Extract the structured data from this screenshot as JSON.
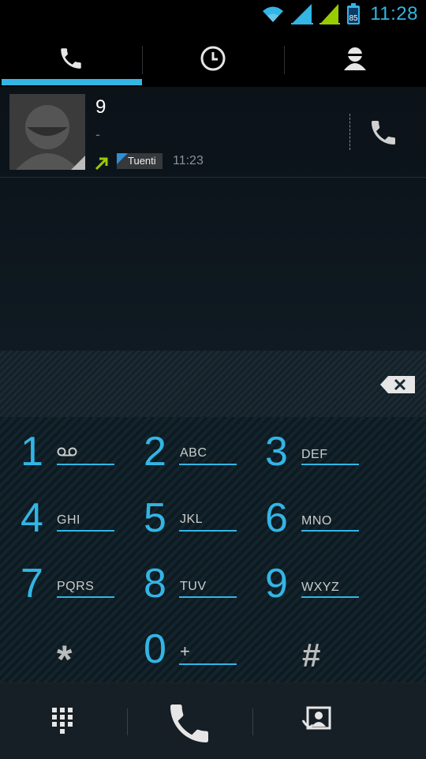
{
  "status_bar": {
    "time": "11:28",
    "battery_level": "85",
    "accent": "#33b5e5"
  },
  "tabs": [
    {
      "id": "phone",
      "icon": "phone-icon",
      "selected": true
    },
    {
      "id": "history",
      "icon": "clock-icon",
      "selected": false
    },
    {
      "id": "contacts",
      "icon": "person-icon",
      "selected": false
    }
  ],
  "call_log": {
    "entry": {
      "name": "9",
      "number_type": "-",
      "direction": "outgoing",
      "account": "Tuenti",
      "time": "11:23"
    }
  },
  "keypad": {
    "keys": [
      {
        "num": "1",
        "letters": ""
      },
      {
        "num": "2",
        "letters": "ABC"
      },
      {
        "num": "3",
        "letters": "DEF"
      },
      {
        "num": "4",
        "letters": "GHI"
      },
      {
        "num": "5",
        "letters": "JKL"
      },
      {
        "num": "6",
        "letters": "MNO"
      },
      {
        "num": "7",
        "letters": "PQRS"
      },
      {
        "num": "8",
        "letters": "TUV"
      },
      {
        "num": "9",
        "letters": "WXYZ"
      },
      {
        "num": "*",
        "letters": ""
      },
      {
        "num": "0",
        "letters": "+"
      },
      {
        "num": "#",
        "letters": ""
      }
    ]
  },
  "bottom_bar": {
    "left_icon": "dialpad-icon",
    "center_icon": "call-icon",
    "right_icon": "contact-card-icon"
  }
}
